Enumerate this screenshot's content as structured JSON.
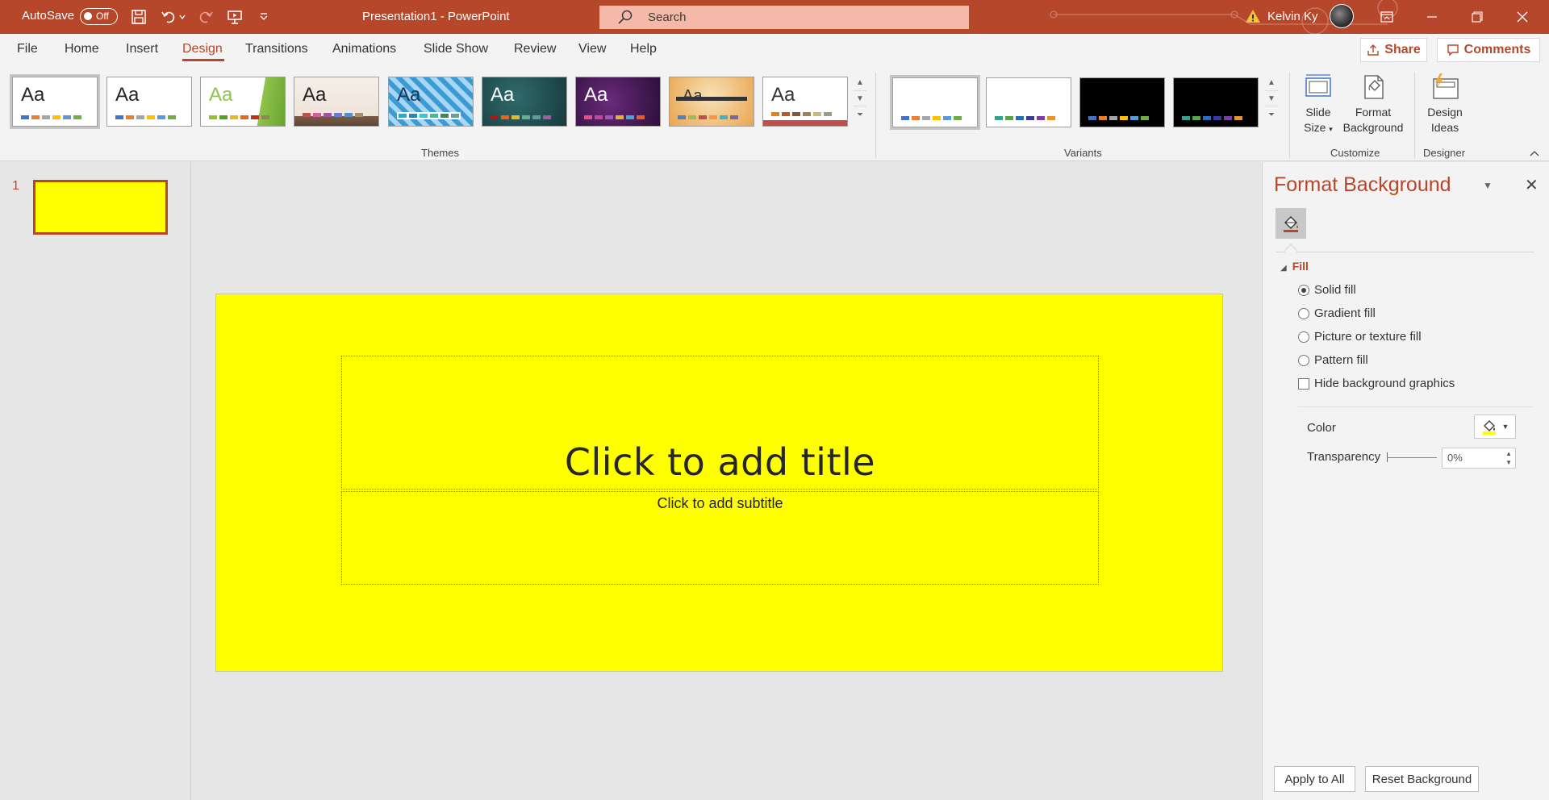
{
  "titlebar": {
    "autosave_label": "AutoSave",
    "autosave_state": "Off",
    "document_title": "Presentation1  -  PowerPoint",
    "search_placeholder": "Search",
    "user_name": "Kelvin Ky"
  },
  "tabs": [
    {
      "label": "File"
    },
    {
      "label": "Home"
    },
    {
      "label": "Insert"
    },
    {
      "label": "Design",
      "active": true
    },
    {
      "label": "Transitions"
    },
    {
      "label": "Animations"
    },
    {
      "label": "Slide Show"
    },
    {
      "label": "Review"
    },
    {
      "label": "View"
    },
    {
      "label": "Help"
    }
  ],
  "share_label": "Share",
  "comments_label": "Comments",
  "ribbon": {
    "themes_label": "Themes",
    "variants_label": "Variants",
    "customize_label": "Customize",
    "designer_label": "Designer",
    "theme_sample": "Aa",
    "slide_size_line1": "Slide",
    "slide_size_line2": "Size",
    "format_bg_line1": "Format",
    "format_bg_line2": "Background",
    "design_ideas_line1": "Design",
    "design_ideas_line2": "Ideas"
  },
  "slides_pane": {
    "slide_number": "1"
  },
  "slide": {
    "background_color": "#ffff00",
    "title_placeholder": "Click to add title",
    "subtitle_placeholder": "Click to add subtitle"
  },
  "format_background": {
    "title": "Format Background",
    "section_fill": "Fill",
    "options": [
      {
        "label": "Solid fill",
        "selected": true
      },
      {
        "label": "Gradient fill",
        "selected": false
      },
      {
        "label": "Picture or texture fill",
        "selected": false
      },
      {
        "label": "Pattern fill",
        "selected": false
      }
    ],
    "hide_graphics_label": "Hide background graphics",
    "hide_graphics_checked": false,
    "color_label": "Color",
    "color_value": "#ffff00",
    "transparency_label": "Transparency",
    "transparency_value": "0%",
    "apply_all_label": "Apply to All",
    "reset_label": "Reset Background"
  },
  "colors": {
    "accent": "#b7472a",
    "slide_fill": "#ffff00"
  }
}
